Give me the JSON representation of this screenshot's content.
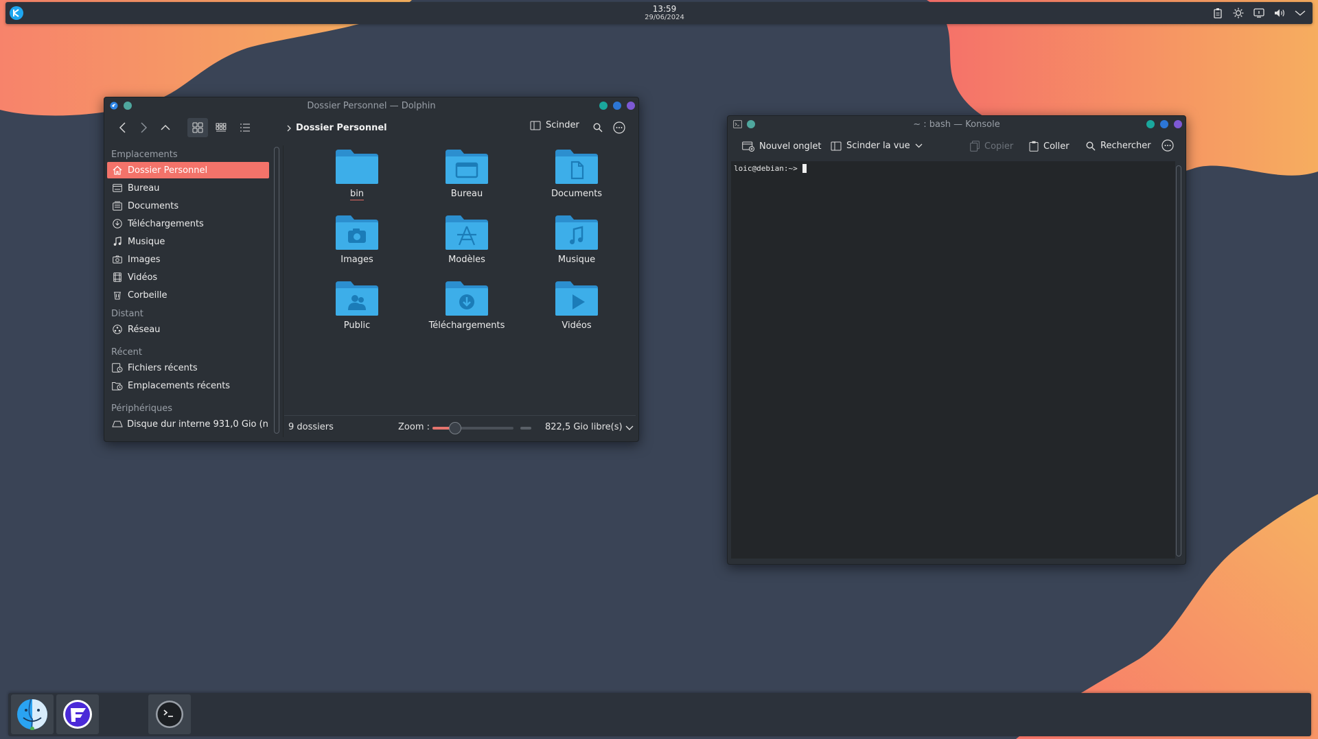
{
  "top_panel": {
    "time": "13:59",
    "date": "29/06/2024",
    "tray_icons": [
      "clipboard-icon",
      "brightness-icon",
      "display-icon",
      "volume-icon",
      "chevron-down-icon"
    ]
  },
  "dolphin": {
    "title": "Dossier Personnel — Dolphin",
    "breadcrumb": "Dossier Personnel",
    "split_label": "Scinder",
    "sidebar": {
      "section_places": "Emplacements",
      "places": [
        {
          "label": "Dossier Personnel",
          "icon": "home-icon",
          "selected": true
        },
        {
          "label": "Bureau",
          "icon": "desktop-icon"
        },
        {
          "label": "Documents",
          "icon": "documents-icon"
        },
        {
          "label": "Téléchargements",
          "icon": "downloads-icon"
        },
        {
          "label": "Musique",
          "icon": "music-icon"
        },
        {
          "label": "Images",
          "icon": "camera-icon"
        },
        {
          "label": "Vidéos",
          "icon": "film-icon"
        },
        {
          "label": "Corbeille",
          "icon": "trash-icon"
        }
      ],
      "section_remote": "Distant",
      "remote": [
        {
          "label": "Réseau",
          "icon": "network-icon"
        }
      ],
      "section_recent": "Récent",
      "recent": [
        {
          "label": "Fichiers récents",
          "icon": "recent-files-icon"
        },
        {
          "label": "Emplacements récents",
          "icon": "recent-places-icon"
        }
      ],
      "section_devices": "Périphériques",
      "devices": [
        {
          "label": "Disque dur interne 931,0 Gio (n...",
          "icon": "drive-icon"
        }
      ]
    },
    "folders": [
      {
        "label": "bin",
        "glyph": "none"
      },
      {
        "label": "Bureau",
        "glyph": "desktop"
      },
      {
        "label": "Documents",
        "glyph": "document"
      },
      {
        "label": "Images",
        "glyph": "camera"
      },
      {
        "label": "Modèles",
        "glyph": "templates"
      },
      {
        "label": "Musique",
        "glyph": "music"
      },
      {
        "label": "Public",
        "glyph": "people"
      },
      {
        "label": "Téléchargements",
        "glyph": "download"
      },
      {
        "label": "Vidéos",
        "glyph": "play"
      }
    ],
    "status": {
      "count": "9 dossiers",
      "zoom_label": "Zoom :",
      "zoom_level": 0.28,
      "free_space": "822,5 Gio libre(s)"
    }
  },
  "konsole": {
    "title": "~ : bash — Konsole",
    "toolbar": {
      "new_tab": "Nouvel onglet",
      "split_view": "Scinder la vue",
      "copy": "Copier",
      "paste": "Coller",
      "search": "Rechercher"
    },
    "prompt": "loic@debian:~>"
  },
  "colors": {
    "accent": "#f3736a",
    "folder": "#3daee9",
    "wallpaper_bg": "#3a4456"
  },
  "dock": {
    "apps": [
      "finder-icon",
      "app-f-icon",
      "terminal-icon"
    ]
  }
}
